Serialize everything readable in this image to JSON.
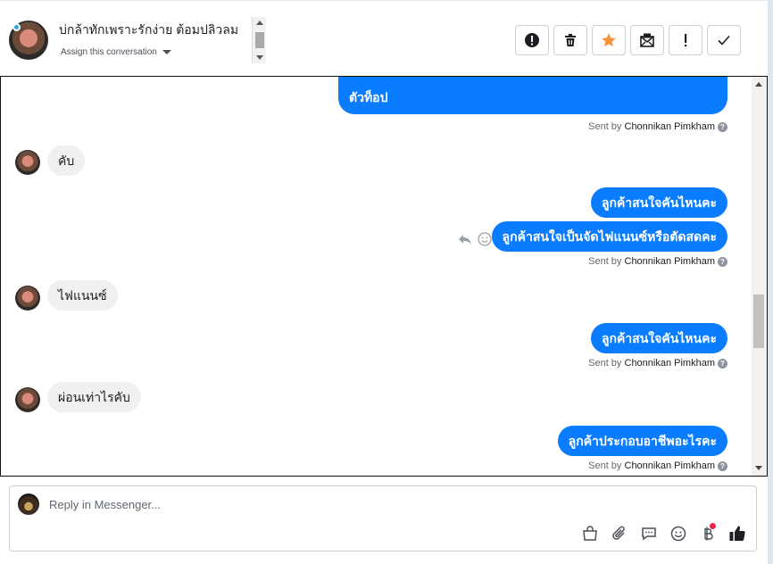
{
  "header": {
    "contact_name": "บ่กล้าทักเพราะรักง่าย ต้อมปลิวลม",
    "assign_label": "Assign this conversation",
    "actions": [
      {
        "name": "spam-button",
        "icon": "exclamation-circle-icon"
      },
      {
        "name": "delete-button",
        "icon": "trash-icon"
      },
      {
        "name": "star-button",
        "icon": "star-icon"
      },
      {
        "name": "mark-unread-button",
        "icon": "envelope-icon"
      },
      {
        "name": "follow-up-button",
        "icon": "exclamation-icon"
      },
      {
        "name": "mark-done-button",
        "icon": "check-icon"
      }
    ]
  },
  "colors": {
    "accent": "#0a7cff",
    "star": "#f7923b",
    "notification_dot": "#f0284a"
  },
  "messages": [
    {
      "dir": "out",
      "text": "ตัวท็อป"
    },
    {
      "dir": "in",
      "text": "คับ"
    },
    {
      "dir": "out",
      "text": "ลูกค้าสนใจคันไหนคะ"
    },
    {
      "dir": "out",
      "text": "ลูกค้าสนใจเป็นจัดไฟแนนซ์หรือตัดสดคะ"
    },
    {
      "dir": "in",
      "text": "ไฟแนนซ์"
    },
    {
      "dir": "out",
      "text": "ลูกค้าสนใจคันไหนคะ"
    },
    {
      "dir": "in",
      "text": "ผ่อนเท่าไรคับ"
    },
    {
      "dir": "out",
      "text": "ลูกค้าประกอบอาชีพอะไรคะ"
    }
  ],
  "sent_by": {
    "prefix": "Sent by",
    "agent": "Chonnikan Pimkham",
    "help": "?"
  },
  "reply": {
    "placeholder": "Reply in Messenger..."
  }
}
